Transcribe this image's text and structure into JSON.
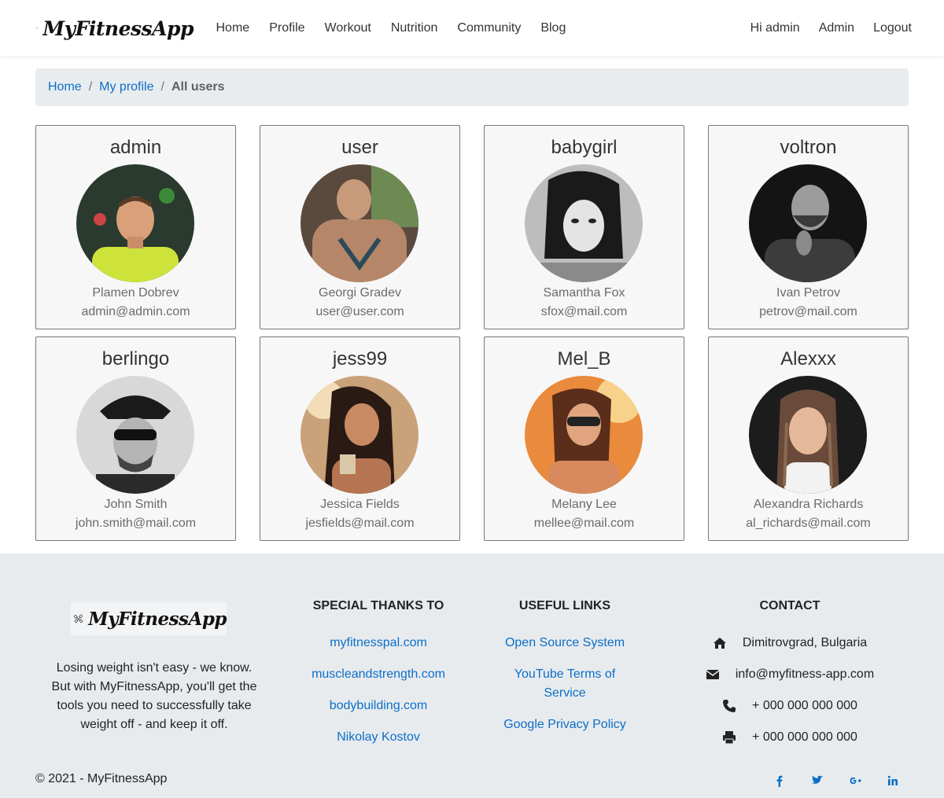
{
  "app": {
    "brand": "MyFitnessApp"
  },
  "nav": {
    "links": [
      "Home",
      "Profile",
      "Workout",
      "Nutrition",
      "Community",
      "Blog"
    ],
    "greeting": "Hi admin",
    "admin": "Admin",
    "logout": "Logout"
  },
  "breadcrumb": {
    "home": "Home",
    "profile": "My profile",
    "current": "All users"
  },
  "users": [
    {
      "username": "admin",
      "full_name": "Plamen Dobrev",
      "email": "admin@admin.com"
    },
    {
      "username": "user",
      "full_name": "Georgi Gradev",
      "email": "user@user.com"
    },
    {
      "username": "babygirl",
      "full_name": "Samantha Fox",
      "email": "sfox@mail.com"
    },
    {
      "username": "voltron",
      "full_name": "Ivan Petrov",
      "email": "petrov@mail.com"
    },
    {
      "username": "berlingo",
      "full_name": "John Smith",
      "email": "john.smith@mail.com"
    },
    {
      "username": "jess99",
      "full_name": "Jessica Fields",
      "email": "jesfields@mail.com"
    },
    {
      "username": "Mel_B",
      "full_name": "Melany Lee",
      "email": "mellee@mail.com"
    },
    {
      "username": "Alexxx",
      "full_name": "Alexandra Richards",
      "email": "al_richards@mail.com"
    }
  ],
  "footer": {
    "description": "Losing weight isn't easy - we know. But with MyFitnessApp, you'll get the tools you need to successfully take weight off - and keep it off.",
    "thanks_heading": "SPECIAL THANKS TO",
    "thanks": [
      "myfitnesspal.com",
      "muscleandstrength.com",
      "bodybuilding.com",
      "Nikolay Kostov"
    ],
    "links_heading": "USEFUL LINKS",
    "links": [
      "Open Source System",
      "YouTube Terms of Service",
      "Google Privacy Policy"
    ],
    "contact_heading": "CONTACT",
    "contact": {
      "address": "Dimitrovgrad, Bulgaria",
      "email": "info@myfitness-app.com",
      "phone": "+ 000 000 000 000",
      "fax": "+ 000 000 000 000"
    },
    "copyright": "© 2021 - MyFitnessApp",
    "socials": [
      "facebook-icon",
      "twitter-icon",
      "google-plus-icon",
      "linkedin-icon"
    ]
  },
  "colors": {
    "link": "#0b6fc8",
    "footer_bg": "#e8ebee",
    "breadcrumb_bg": "#e9ecef"
  }
}
